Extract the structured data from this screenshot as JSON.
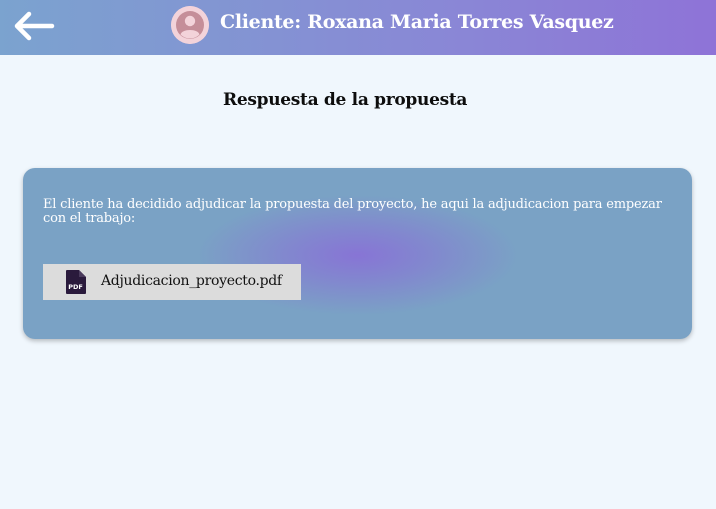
{
  "header": {
    "back_icon": "arrow-left-icon",
    "avatar_icon": "user-icon",
    "title": "Cliente: Roxana Maria Torres Vasquez",
    "gradient_start": "#7ba3cf",
    "gradient_end": "#8e73d7"
  },
  "main": {
    "heading": "Respuesta de la propuesta",
    "card": {
      "message": "El cliente ha decidido adjudicar la propuesta del proyecto, he aqui la adjudicacion para empezar con el trabajo:",
      "background": "#7aa2c5",
      "attachment": {
        "icon": "pdf-file-icon",
        "filename": "Adjudicacion_proyecto.pdf"
      }
    }
  }
}
